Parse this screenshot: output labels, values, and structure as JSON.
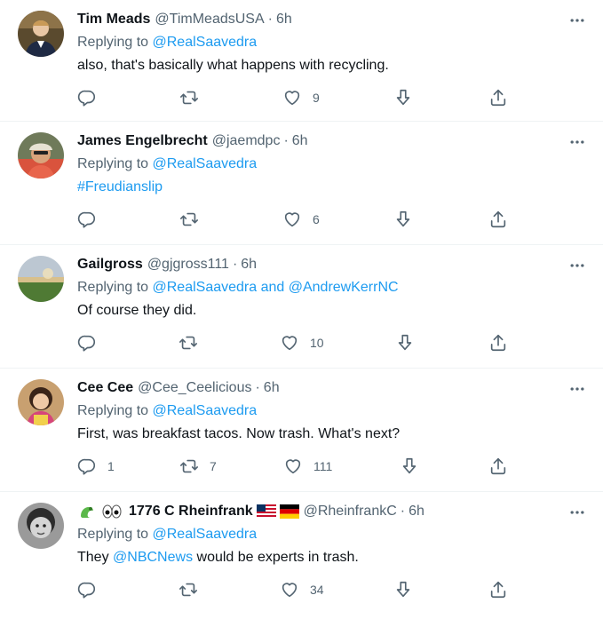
{
  "tweets": [
    {
      "name": "Tim Meads",
      "handle": "@TimMeadsUSA",
      "time": "6h",
      "replying_prefix": "Replying to",
      "replying_to": "@RealSaavedra",
      "text": "also, that's basically what happens with recycling.",
      "likes": "9"
    },
    {
      "name": "James Engelbrecht",
      "handle": "@jaemdpc",
      "time": "6h",
      "replying_prefix": "Replying to",
      "replying_to": "@RealSaavedra",
      "text_link": "#Freudianslip",
      "likes": "6"
    },
    {
      "name": "Gailgross",
      "handle": "@gjgross111",
      "time": "6h",
      "replying_prefix": "Replying to",
      "replying_to": "@RealSaavedra and @AndrewKerrNC",
      "text": "Of course they did.",
      "likes": "10"
    },
    {
      "name": "Cee Cee",
      "handle": "@Cee_Ceelicious",
      "time": "6h",
      "replying_prefix": "Replying to",
      "replying_to": "@RealSaavedra",
      "text": "First, was breakfast tacos. Now trash. What's next?",
      "replies": "1",
      "retweets": "7",
      "likes": "111"
    },
    {
      "name": "1776 C Rheinfrank",
      "handle": "@RheinfrankC",
      "time": "6h",
      "replying_prefix": "Replying to",
      "replying_to": "@RealSaavedra",
      "text_pre": "They",
      "text_link": "@NBCNews",
      "text_post": "would be experts in trash.",
      "likes": "34"
    }
  ],
  "separator": "·",
  "icons": {
    "reply": "reply-icon",
    "retweet": "retweet-icon",
    "like": "heart-icon",
    "downvote": "downvote-icon",
    "share": "share-icon",
    "more": "more-icon"
  },
  "colors": {
    "accent": "#1d9bf0",
    "secondary_text": "#536471",
    "primary_text": "#0f1419",
    "divider": "#eff3f4"
  }
}
